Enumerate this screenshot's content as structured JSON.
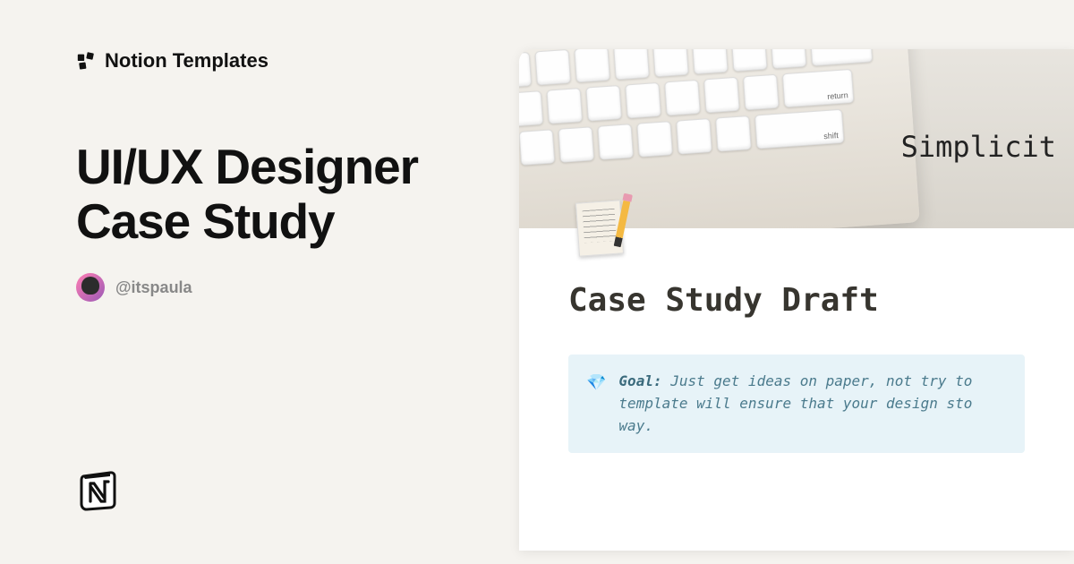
{
  "brand": {
    "name": "Notion Templates"
  },
  "template": {
    "title": "UI/UX Designer Case Study",
    "author_handle": "@itspaula"
  },
  "preview": {
    "cover_text": "Simplicit",
    "keyboard_keys": {
      "return": "return",
      "shift": "shift"
    },
    "page_title": "Case Study Draft",
    "callout": {
      "icon": "💎",
      "label": "Goal:",
      "text_line1": "Just get ideas on paper, not try to",
      "text_line2": "template will ensure that your design sto",
      "text_line3": "way."
    }
  }
}
